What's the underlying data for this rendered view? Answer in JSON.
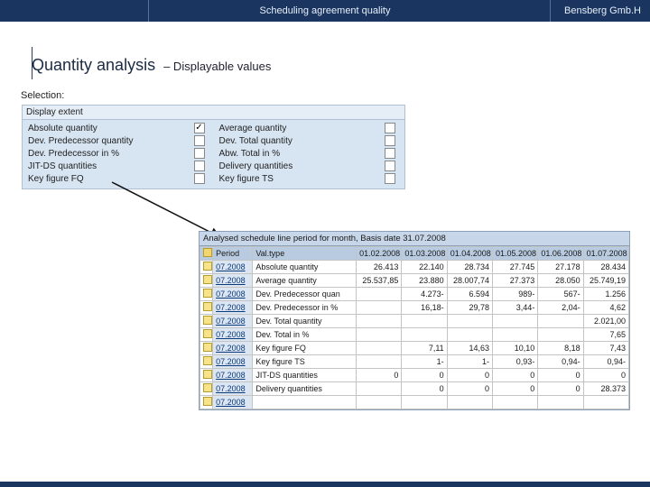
{
  "banner": {
    "title": "Scheduling agreement quality",
    "brand": "Bensberg Gmb.H"
  },
  "heading": {
    "main": "Quantity analysis",
    "sub": "– Displayable values"
  },
  "labels": {
    "selection": "Selection:"
  },
  "selection": {
    "header": "Display extent",
    "rows": [
      {
        "left": "Absolute quantity",
        "left_checked": true,
        "right": "Average quantity",
        "right_checked": false
      },
      {
        "left": "Dev. Predecessor quantity",
        "left_checked": false,
        "right": "Dev. Total quantity",
        "right_checked": false
      },
      {
        "left": "Dev. Predecessor in %",
        "left_checked": false,
        "right": "Abw. Total in %",
        "right_checked": false
      },
      {
        "left": "JIT-DS quantities",
        "left_checked": false,
        "right": "Delivery quantities",
        "right_checked": false
      },
      {
        "left": "Key figure FQ",
        "left_checked": false,
        "right": "Key figure TS",
        "right_checked": false
      }
    ]
  },
  "table": {
    "title": "Analysed schedule line period for month, Basis date 31.07.2008",
    "columns": {
      "period": "Period",
      "valtype": "Val.type",
      "months": [
        "01.02.2008",
        "01.03.2008",
        "01.04.2008",
        "01.05.2008",
        "01.06.2008",
        "01.07.2008"
      ]
    },
    "rows": [
      {
        "period": "07.2008",
        "valtype": "Absolute quantity",
        "cells": [
          "26.413",
          "22.140",
          "28.734",
          "27.745",
          "27.178",
          "28.434"
        ]
      },
      {
        "period": "07.2008",
        "valtype": "Average quantity",
        "cells": [
          "25.537,85",
          "23.880",
          "28.007,74",
          "27.373",
          "28.050",
          "25.749,19"
        ]
      },
      {
        "period": "07.2008",
        "valtype": "Dev. Predecessor quan",
        "cells": [
          "",
          "4.273-",
          "6.594",
          "989-",
          "567-",
          "1.256"
        ]
      },
      {
        "period": "07.2008",
        "valtype": "Dev. Predecessor in %",
        "cells": [
          "",
          "16,18-",
          "29,78",
          "3,44-",
          "2,04-",
          "4,62"
        ]
      },
      {
        "period": "07.2008",
        "valtype": "Dev. Total quantity",
        "cells": [
          "",
          "",
          "",
          "",
          "",
          "2.021,00"
        ]
      },
      {
        "period": "07.2008",
        "valtype": "Dev. Total in %",
        "cells": [
          "",
          "",
          "",
          "",
          "",
          "7,65"
        ]
      },
      {
        "period": "07.2008",
        "valtype": "Key figure FQ",
        "cells": [
          "",
          "7,11",
          "14,63",
          "10,10",
          "8,18",
          "7,43"
        ]
      },
      {
        "period": "07.2008",
        "valtype": "Key figure TS",
        "cells": [
          "",
          "1-",
          "1-",
          "0,93-",
          "0,94-",
          "0,94-"
        ]
      },
      {
        "period": "07.2008",
        "valtype": "JIT-DS quantities",
        "cells": [
          "0",
          "0",
          "0",
          "0",
          "0",
          "0"
        ]
      },
      {
        "period": "07.2008",
        "valtype": "Delivery quantities",
        "cells": [
          "",
          "0",
          "0",
          "0",
          "0",
          "28.373"
        ]
      },
      {
        "period": "07.2008",
        "valtype": "",
        "cells": [
          "",
          "",
          "",
          "",
          "",
          ""
        ]
      }
    ]
  }
}
